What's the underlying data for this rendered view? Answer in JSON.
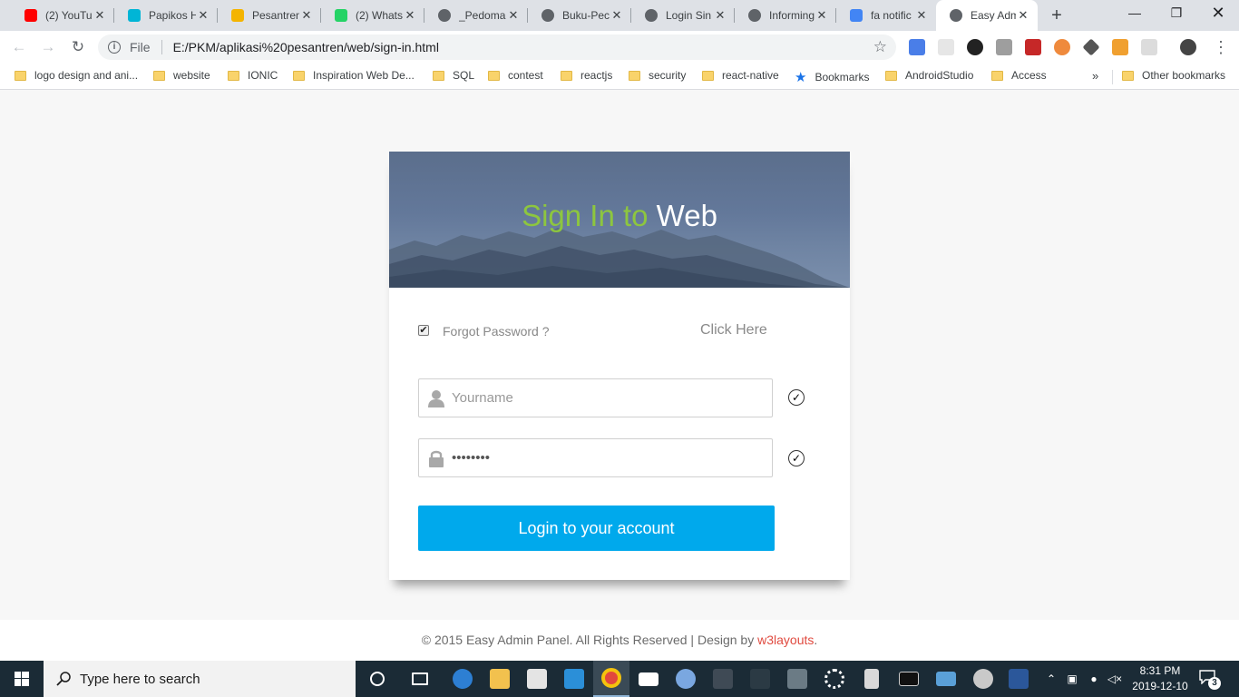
{
  "browser": {
    "tabs": [
      {
        "title": "(2) YouTu",
        "icon": "youtube-icon",
        "color": "#ff0000",
        "active": false
      },
      {
        "title": "Papikos H",
        "icon": "papikos-icon",
        "color": "#00b5d6",
        "active": false
      },
      {
        "title": "Pesantren",
        "icon": "google-drive-icon",
        "color": "#f4b400",
        "active": false
      },
      {
        "title": "(2) Whats",
        "icon": "whatsapp-icon",
        "color": "#25d366",
        "active": false
      },
      {
        "title": "_Pedoma",
        "icon": "globe-icon",
        "color": "#5f6368",
        "active": false
      },
      {
        "title": "Buku-Pec",
        "icon": "globe-icon",
        "color": "#5f6368",
        "active": false
      },
      {
        "title": "Login Sin",
        "icon": "globe-icon",
        "color": "#5f6368",
        "active": false
      },
      {
        "title": "Informing",
        "icon": "globe-icon",
        "color": "#5f6368",
        "active": false
      },
      {
        "title": "fa notific",
        "icon": "google-icon",
        "color": "#4285f4",
        "active": false
      },
      {
        "title": "Easy Adm",
        "icon": "globe-icon",
        "color": "#5f6368",
        "active": true
      }
    ],
    "new_tab": "+",
    "omnibox": {
      "file_label": "File",
      "url": "E:/PKM/aplikasi%20pesantren/web/sign-in.html"
    },
    "bookmarks": [
      {
        "label": "logo design and ani...",
        "type": "folder"
      },
      {
        "label": "website",
        "type": "folder"
      },
      {
        "label": "IONIC",
        "type": "folder"
      },
      {
        "label": "Inspiration Web De...",
        "type": "folder"
      },
      {
        "label": "SQL",
        "type": "folder"
      },
      {
        "label": "contest",
        "type": "folder"
      },
      {
        "label": "reactjs",
        "type": "folder"
      },
      {
        "label": "security",
        "type": "folder"
      },
      {
        "label": "react-native",
        "type": "folder"
      },
      {
        "label": "Bookmarks",
        "type": "star"
      },
      {
        "label": "AndroidStudio",
        "type": "folder"
      },
      {
        "label": "Access",
        "type": "folder"
      }
    ],
    "overflow": "»",
    "other_bookmarks": "Other bookmarks"
  },
  "signin": {
    "title_part1": "Sign In to",
    "title_part2": "Web",
    "forgot_label": "Forgot Password ?",
    "click_here": "Click Here",
    "username_placeholder": "Yourname",
    "password_value": "password",
    "login_button": "Login to your account",
    "accent_green": "#8dc63f",
    "button_color": "#00a9ec"
  },
  "footer": {
    "text": "© 2015 Easy Admin Panel. All Rights Reserved | Design by ",
    "brand": "w3layouts",
    "period": "."
  },
  "taskbar": {
    "search_placeholder": "Type here to search",
    "time": "8:31 PM",
    "date": "2019-12-10",
    "notification_count": "3"
  }
}
